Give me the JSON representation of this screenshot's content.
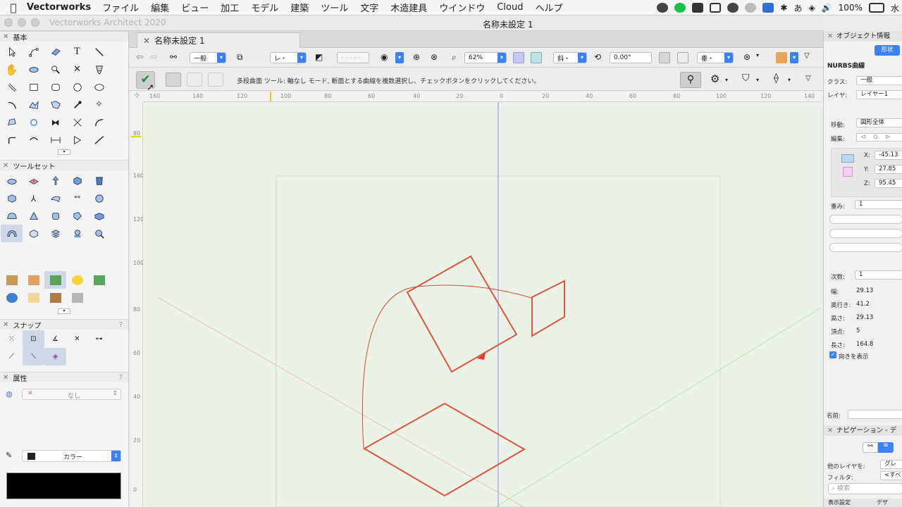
{
  "menubar": {
    "app_name": "Vectorworks",
    "items": [
      "ファイル",
      "編集",
      "ビュー",
      "加工",
      "モデル",
      "建築",
      "ツール",
      "文字",
      "木造建具",
      "ウインドウ",
      "Cloud",
      "ヘルプ"
    ],
    "ime": "あ",
    "battery": "100%",
    "clock": "水"
  },
  "window": {
    "app_title": "Vectorworks Architect 2020",
    "doc_title": "名称未設定 1",
    "tab_label": "名称未設定 1"
  },
  "left_panel": {
    "basic_title": "基本",
    "toolset_title": "ツールセット",
    "snap_title": "スナップ",
    "attr_title": "属性",
    "attr_fill_value": "なし",
    "attr_pen_value": "カラー"
  },
  "view_bar": {
    "class_value": "一般",
    "layer_value": "レ・",
    "zoom_value": "62%",
    "view_value": "斜・",
    "angle_value": "0.00°",
    "render_value": "垂・"
  },
  "mode_bar": {
    "hint_text": "多段曲面 ツール: 軸なし モード, 断面とする曲線を複数選択し、チェックボタンをクリックしてください。"
  },
  "rulers": {
    "top_ticks": [
      "160",
      "140",
      "120",
      "100",
      "80",
      "60",
      "40",
      "20",
      "0",
      "20",
      "40",
      "60",
      "80",
      "100",
      "120",
      "140"
    ],
    "left_ticks": [
      "80",
      "160",
      "120",
      "100",
      "80",
      "60",
      "40",
      "20",
      "0"
    ]
  },
  "obj_info": {
    "title": "オブジェクト情報",
    "tab_label": "形状",
    "object_type": "NURBS曲線",
    "class_label": "クラス:",
    "class_value": "一般",
    "layer_label": "レイヤ:",
    "layer_value": "レイヤー1",
    "move_label": "移動:",
    "move_value": "図形全体",
    "edit_label": "編集:",
    "x_label": "X:",
    "x_value": "-45.13",
    "y_label": "Y:",
    "y_value": "27.85",
    "z_label": "Z:",
    "z_value": "95.45",
    "weight_label": "重み:",
    "weight_value": "1",
    "degree_label": "次数:",
    "degree_value": "1",
    "width_label": "幅:",
    "width_value": "29.13",
    "depth_label": "奥行き:",
    "depth_value": "41.2",
    "height_label": "高さ:",
    "height_value": "29.13",
    "vertex_label": "頂点:",
    "vertex_value": "5",
    "length_label": "長さ:",
    "length_value": "164.8",
    "show_dir_label": "向きを表示",
    "name_label": "名前:"
  },
  "navigation": {
    "title": "ナビゲーション - デ",
    "other_layers_label": "他のレイヤを:",
    "other_layers_value": "グレ",
    "filter_label": "フィルタ:",
    "filter_value": "<すべ",
    "search_placeholder": "検索",
    "col_display": "表示設定",
    "col_design": "デザ"
  },
  "colors": {
    "accent": "#3b82f6",
    "shape_stroke": "#e0533c",
    "canvas_bg": "#eaf1e6"
  }
}
